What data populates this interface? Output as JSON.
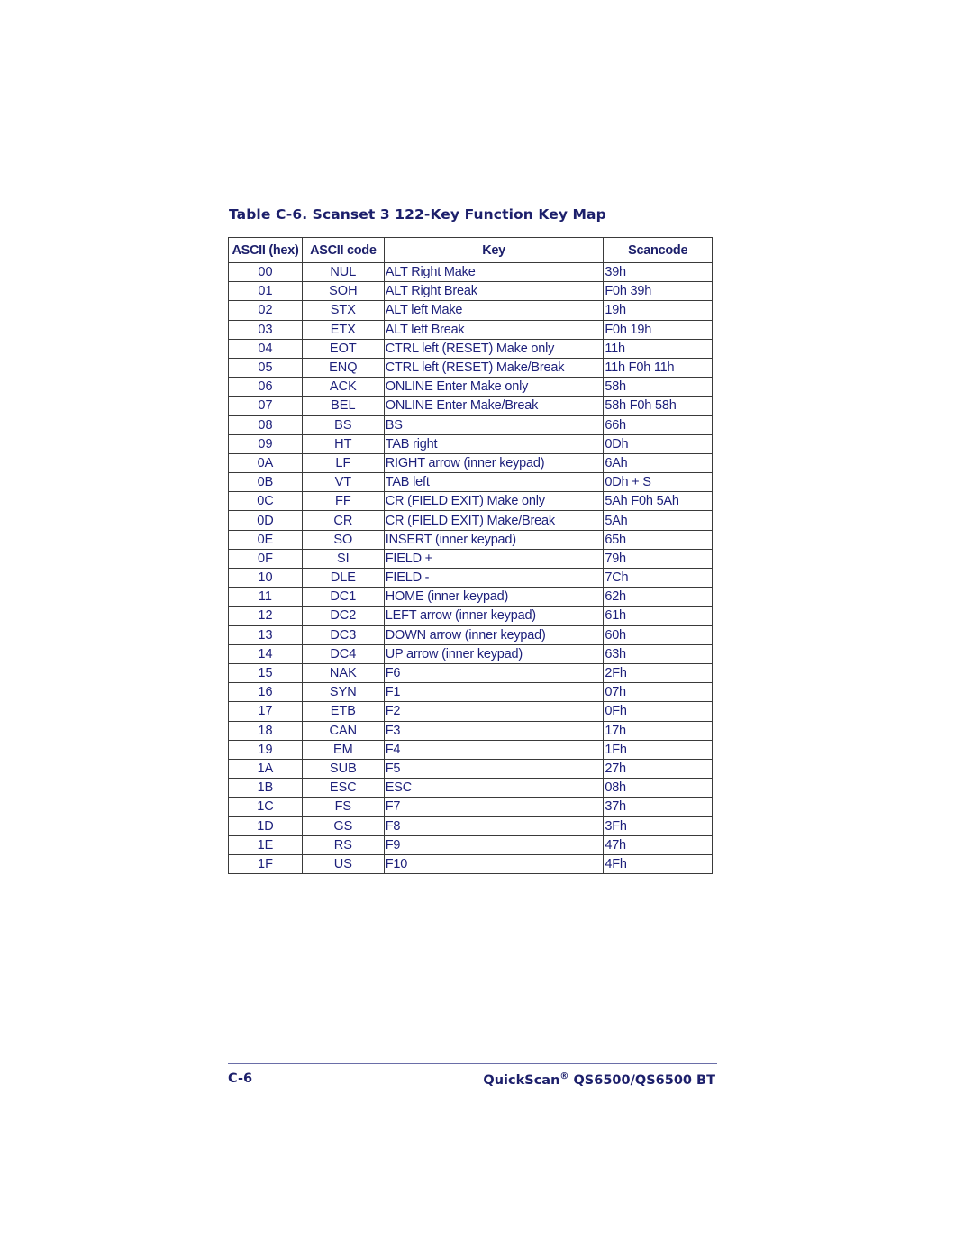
{
  "table_title": "Table C-6. Scanset 3 122-Key Function Key Map",
  "columns": [
    "ASCII (hex)",
    "ASCII code",
    "Key",
    "Scancode"
  ],
  "rows": [
    [
      "00",
      "NUL",
      "ALT Right Make",
      "39h"
    ],
    [
      "01",
      "SOH",
      "ALT Right Break",
      "F0h 39h"
    ],
    [
      "02",
      "STX",
      "ALT left Make",
      "19h"
    ],
    [
      "03",
      "ETX",
      "ALT left Break",
      "F0h 19h"
    ],
    [
      "04",
      "EOT",
      "CTRL left (RESET) Make only",
      "11h"
    ],
    [
      "05",
      "ENQ",
      "CTRL left (RESET) Make/Break",
      "11h F0h 11h"
    ],
    [
      "06",
      "ACK",
      "ONLINE Enter Make only",
      "58h"
    ],
    [
      "07",
      "BEL",
      "ONLINE Enter Make/Break",
      "58h F0h 58h"
    ],
    [
      "08",
      "BS",
      "BS",
      "66h"
    ],
    [
      "09",
      "HT",
      "TAB right",
      "0Dh"
    ],
    [
      "0A",
      "LF",
      "RIGHT arrow (inner keypad)",
      "6Ah"
    ],
    [
      "0B",
      "VT",
      "TAB left",
      "0Dh + S"
    ],
    [
      "0C",
      "FF",
      "CR (FIELD EXIT) Make only",
      "5Ah F0h 5Ah"
    ],
    [
      "0D",
      "CR",
      "CR (FIELD EXIT) Make/Break",
      "5Ah"
    ],
    [
      "0E",
      "SO",
      "INSERT (inner keypad)",
      "65h"
    ],
    [
      "0F",
      "SI",
      "FIELD +",
      "79h"
    ],
    [
      "10",
      "DLE",
      "FIELD -",
      "7Ch"
    ],
    [
      "11",
      "DC1",
      "HOME (inner keypad)",
      "62h"
    ],
    [
      "12",
      "DC2",
      "LEFT arrow (inner keypad)",
      "61h"
    ],
    [
      "13",
      "DC3",
      "DOWN arrow (inner keypad)",
      "60h"
    ],
    [
      "14",
      "DC4",
      "UP arrow (inner keypad)",
      "63h"
    ],
    [
      "15",
      "NAK",
      "F6",
      "2Fh"
    ],
    [
      "16",
      "SYN",
      "F1",
      "07h"
    ],
    [
      "17",
      "ETB",
      "F2",
      "0Fh"
    ],
    [
      "18",
      "CAN",
      "F3",
      "17h"
    ],
    [
      "19",
      "EM",
      "F4",
      "1Fh"
    ],
    [
      "1A",
      "SUB",
      "F5",
      "27h"
    ],
    [
      "1B",
      "ESC",
      "ESC",
      "08h"
    ],
    [
      "1C",
      "FS",
      "F7",
      "37h"
    ],
    [
      "1D",
      "GS",
      "F8",
      "3Fh"
    ],
    [
      "1E",
      "RS",
      "F9",
      "47h"
    ],
    [
      "1F",
      "US",
      "F10",
      "4Fh"
    ]
  ],
  "footer": {
    "page_number": "C-6",
    "product_name": "QuickScan",
    "registered_mark": "®",
    "product_model": " QS6500/QS6500 BT"
  },
  "colors": {
    "text": "#1c1f7a",
    "heading": "#1c1f6b",
    "rule": "#4b4f8f"
  }
}
